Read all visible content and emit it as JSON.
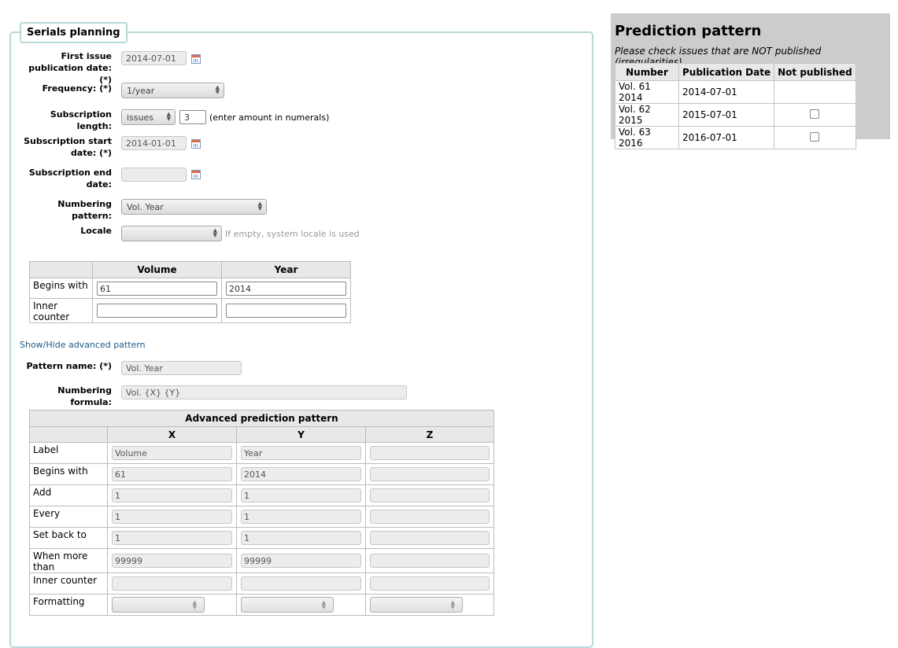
{
  "form": {
    "legend": "Serials planning",
    "first_issue_label": "First issue publication date: (*)",
    "first_issue_value": "2014-07-01",
    "frequency_label": "Frequency: (*)",
    "frequency_value": "1/year",
    "sub_length_label": "Subscription length:",
    "sub_length_unit": "issues",
    "sub_length_value": "3",
    "sub_length_note": "(enter amount in numerals)",
    "sub_start_label": "Subscription start date: (*)",
    "sub_start_value": "2014-01-01",
    "sub_end_label": "Subscription end date:",
    "sub_end_value": "",
    "numbering_label": "Numbering pattern:",
    "numbering_value": "Vol. Year",
    "locale_label": "Locale",
    "locale_value": "",
    "locale_hint": "If empty, system locale is used"
  },
  "numbering_table": {
    "headers": [
      "Volume",
      "Year"
    ],
    "rows": [
      {
        "label": "Begins with",
        "values": [
          "61",
          "2014"
        ]
      },
      {
        "label": "Inner counter",
        "values": [
          "",
          ""
        ]
      }
    ]
  },
  "advanced": {
    "toggle_link": "Show/Hide advanced pattern",
    "pattern_name_label": "Pattern name: (*)",
    "pattern_name_value": "Vol. Year",
    "formula_label": "Numbering formula:",
    "formula_value": "Vol. {X} {Y}",
    "table_title": "Advanced prediction pattern",
    "columns": [
      "X",
      "Y",
      "Z"
    ],
    "rows": [
      {
        "label": "Label",
        "values": [
          "Volume",
          "Year",
          ""
        ]
      },
      {
        "label": "Begins with",
        "values": [
          "61",
          "2014",
          ""
        ]
      },
      {
        "label": "Add",
        "values": [
          "1",
          "1",
          ""
        ]
      },
      {
        "label": "Every",
        "values": [
          "1",
          "1",
          ""
        ]
      },
      {
        "label": "Set back to",
        "values": [
          "1",
          "1",
          ""
        ]
      },
      {
        "label": "When more than",
        "values": [
          "99999",
          "99999",
          ""
        ]
      },
      {
        "label": "Inner counter",
        "values": [
          "",
          "",
          ""
        ]
      }
    ],
    "formatting_label": "Formatting"
  },
  "prediction": {
    "title": "Prediction pattern",
    "subtitle": "Please check issues that are NOT published (irregularities)",
    "headers": [
      "Number",
      "Publication Date",
      "Not published"
    ],
    "rows": [
      {
        "number": "Vol. 61 2014",
        "date": "2014-07-01",
        "checkbox": false
      },
      {
        "number": "Vol. 62 2015",
        "date": "2015-07-01",
        "checkbox": true
      },
      {
        "number": "Vol. 63 2016",
        "date": "2016-07-01",
        "checkbox": true
      }
    ]
  }
}
